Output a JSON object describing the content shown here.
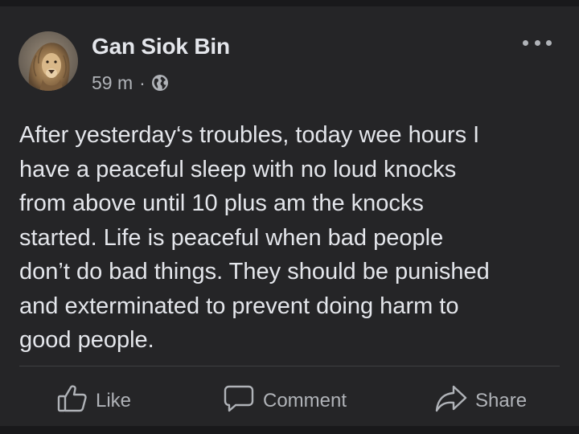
{
  "post": {
    "author": "Gan Siok Bin",
    "time": "59 m",
    "separator": "·",
    "privacy_icon": "globe-icon",
    "options_icon": "more-horizontal-icon",
    "text_lines": [
      "After yesterday‘s troubles, today wee hours I",
      "have a peaceful sleep with no loud knocks",
      "from above until 10 plus am the knocks",
      "started. Life is peaceful when bad people",
      "don’t do bad things. They should be punished",
      "and exterminated to prevent doing harm to",
      "good people."
    ]
  },
  "actions": {
    "like": {
      "label": "Like",
      "icon": "thumbs-up-icon"
    },
    "comment": {
      "label": "Comment",
      "icon": "comment-bubble-icon"
    },
    "share": {
      "label": "Share",
      "icon": "share-arrow-icon"
    }
  },
  "colors": {
    "card_background": "#252527",
    "page_background": "#1b1b1d",
    "primary_text": "#e4e6eb",
    "secondary_text": "#b0b3b8",
    "divider": "#3e4042"
  }
}
